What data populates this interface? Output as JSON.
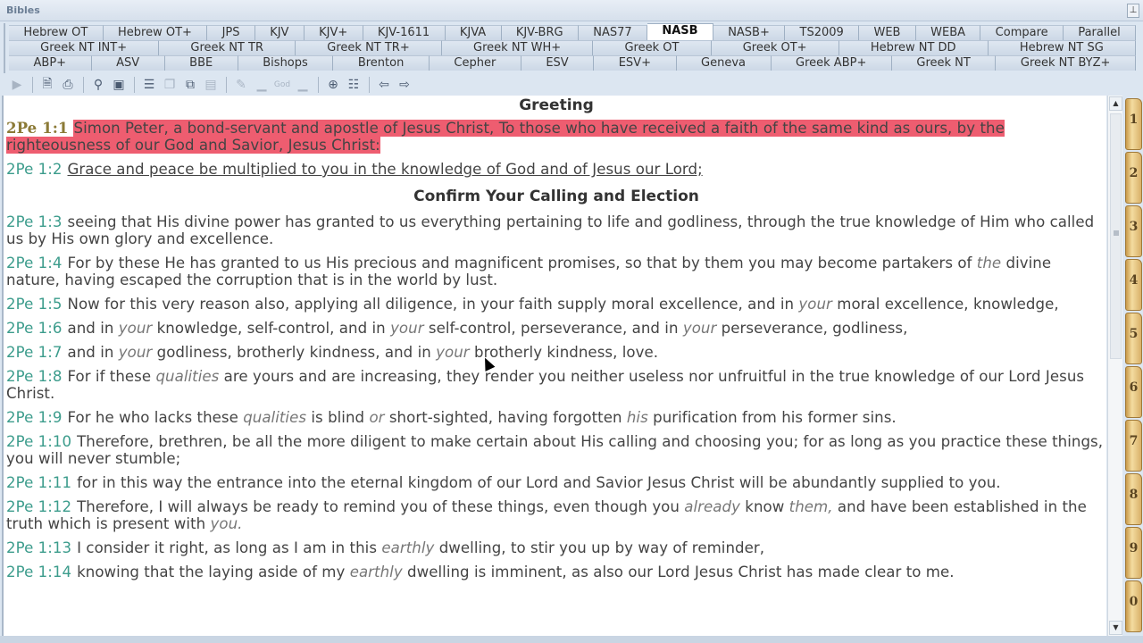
{
  "window": {
    "title": "Bibles",
    "pin_icon": "pin-icon"
  },
  "tabs": {
    "row1": [
      "Hebrew OT",
      "Hebrew OT+",
      "JPS",
      "KJV",
      "KJV+",
      "KJV-1611",
      "KJVA",
      "KJV-BRG",
      "NAS77",
      "NASB",
      "NASB+",
      "TS2009",
      "WEB",
      "WEBA",
      "Compare",
      "Parallel"
    ],
    "row2": [
      "Greek NT INT+",
      "Greek NT TR",
      "Greek NT TR+",
      "Greek NT WH+",
      "Greek OT",
      "Greek OT+",
      "Hebrew NT DD",
      "Hebrew NT SG"
    ],
    "row3": [
      "ABP+",
      "ASV",
      "BBE",
      "Bishops",
      "Brenton",
      "Cepher",
      "ESV",
      "ESV+",
      "Geneva",
      "Greek ABP+",
      "Greek NT",
      "Greek NT BYZ+"
    ],
    "active": "NASB"
  },
  "toolbar": {
    "buttons": [
      {
        "name": "expand-arrow-icon",
        "glyph": "▶",
        "dim": true
      },
      {
        "sep": true
      },
      {
        "name": "print-preview-icon",
        "glyph": "🗎"
      },
      {
        "name": "print-icon",
        "glyph": "⎙"
      },
      {
        "sep": true
      },
      {
        "name": "binoculars-search-icon",
        "glyph": "⚲"
      },
      {
        "name": "lookup-icon",
        "glyph": "▣"
      },
      {
        "sep": true
      },
      {
        "name": "copy-verses-icon",
        "glyph": "☰"
      },
      {
        "name": "copy-icon",
        "glyph": "❐",
        "dim": true
      },
      {
        "name": "copy-add-icon",
        "glyph": "⧉"
      },
      {
        "name": "copy-special-icon",
        "glyph": "▤",
        "dim": true
      },
      {
        "sep": true
      },
      {
        "name": "highlight-icon",
        "glyph": "✎",
        "dim": true
      },
      {
        "name": "highlight-2-icon",
        "glyph": "▁",
        "dim": true
      },
      {
        "name": "god-font-icon",
        "glyph": "God",
        "dim": true
      },
      {
        "name": "highlight-3-icon",
        "glyph": "▁",
        "dim": true
      },
      {
        "sep": true
      },
      {
        "name": "zoom-in-icon",
        "glyph": "⊕"
      },
      {
        "name": "split-view-icon",
        "glyph": "☷"
      },
      {
        "sep": true
      },
      {
        "name": "sync-back-icon",
        "glyph": "⇦"
      },
      {
        "name": "sync-forward-icon",
        "glyph": "⇨"
      }
    ]
  },
  "content": {
    "heading1": "Greeting",
    "heading2": "Confirm Your Calling and Election",
    "verses": [
      {
        "ref": "2Pe 1:1",
        "parts": [
          {
            "t": "Simon Peter, a bond-servant and apostle of Jesus Christ, To those who have received a faith of the same kind as ours, by the righteousness of our God and Savior, Jesus Christ:",
            "s": "hl"
          }
        ]
      },
      {
        "ref": "2Pe 1:2",
        "parts": [
          {
            "t": "Grace and peace be multiplied to you in the knowledge of God and of Jesus our Lord;",
            "s": "ul"
          }
        ]
      },
      {
        "ref": "2Pe 1:3",
        "parts": [
          {
            "t": "seeing that His divine power has granted to us everything pertaining to life and godliness, through the true knowledge of Him who called us by His own glory and excellence."
          }
        ]
      },
      {
        "ref": "2Pe 1:4",
        "parts": [
          {
            "t": "For by these He has granted to us His precious and magnificent promises, so that by them you may become partakers of "
          },
          {
            "t": "the",
            "s": "it"
          },
          {
            "t": " divine nature, having escaped the corruption that is in the world by lust."
          }
        ]
      },
      {
        "ref": "2Pe 1:5",
        "parts": [
          {
            "t": "Now for this very reason also, applying all diligence, in your faith supply moral excellence, and in "
          },
          {
            "t": "your",
            "s": "it"
          },
          {
            "t": " moral excellence, knowledge,"
          }
        ]
      },
      {
        "ref": "2Pe 1:6",
        "parts": [
          {
            "t": "and in "
          },
          {
            "t": "your",
            "s": "it"
          },
          {
            "t": " knowledge, self-control, and in "
          },
          {
            "t": "your",
            "s": "it"
          },
          {
            "t": " self-control, perseverance, and in "
          },
          {
            "t": "your",
            "s": "it"
          },
          {
            "t": " perseverance, godliness,"
          }
        ]
      },
      {
        "ref": "2Pe 1:7",
        "parts": [
          {
            "t": "and in "
          },
          {
            "t": "your",
            "s": "it"
          },
          {
            "t": " godliness, brotherly kindness, and in "
          },
          {
            "t": "your",
            "s": "it"
          },
          {
            "t": " brotherly kindness, love."
          }
        ]
      },
      {
        "ref": "2Pe 1:8",
        "parts": [
          {
            "t": "For if these "
          },
          {
            "t": "qualities",
            "s": "it"
          },
          {
            "t": " are yours and are increasing, they render you neither useless nor unfruitful in the true knowledge of our Lord Jesus Christ."
          }
        ]
      },
      {
        "ref": "2Pe 1:9",
        "parts": [
          {
            "t": "For he who lacks these "
          },
          {
            "t": "qualities",
            "s": "it"
          },
          {
            "t": " is blind "
          },
          {
            "t": "or",
            "s": "it"
          },
          {
            "t": " short-sighted, having forgotten "
          },
          {
            "t": "his",
            "s": "it"
          },
          {
            "t": " purification from his former sins."
          }
        ]
      },
      {
        "ref": "2Pe 1:10",
        "parts": [
          {
            "t": "Therefore, brethren, be all the more diligent to make certain about His calling and choosing you; for as long as you practice these things, you will never stumble;"
          }
        ]
      },
      {
        "ref": "2Pe 1:11",
        "parts": [
          {
            "t": "for in this way the entrance into the eternal kingdom of our Lord and Savior Jesus Christ will be abundantly supplied to you."
          }
        ]
      },
      {
        "ref": "2Pe 1:12",
        "parts": [
          {
            "t": "Therefore, I will always be ready to remind you of these things, even though you "
          },
          {
            "t": "already",
            "s": "it"
          },
          {
            "t": " know "
          },
          {
            "t": "them,",
            "s": "it"
          },
          {
            "t": " and have been established in the truth which is present with "
          },
          {
            "t": "you.",
            "s": "it"
          }
        ]
      },
      {
        "ref": "2Pe 1:13",
        "parts": [
          {
            "t": "I consider it right, as long as I am in this "
          },
          {
            "t": "earthly",
            "s": "it"
          },
          {
            "t": " dwelling, to stir you up by way of reminder,"
          }
        ]
      },
      {
        "ref": "2Pe 1:14",
        "parts": [
          {
            "t": "knowing that the laying aside of my "
          },
          {
            "t": "earthly",
            "s": "it"
          },
          {
            "t": " dwelling is imminent, as also our Lord Jesus Christ has made clear to me."
          }
        ]
      }
    ]
  },
  "chapters": [
    "1",
    "2",
    "3",
    "4",
    "5",
    "6",
    "7",
    "8",
    "9",
    "0"
  ],
  "colors": {
    "highlight": "#ee5d70",
    "verse_ref": "#3c9c8c",
    "first_ref": "#8b7a36"
  }
}
